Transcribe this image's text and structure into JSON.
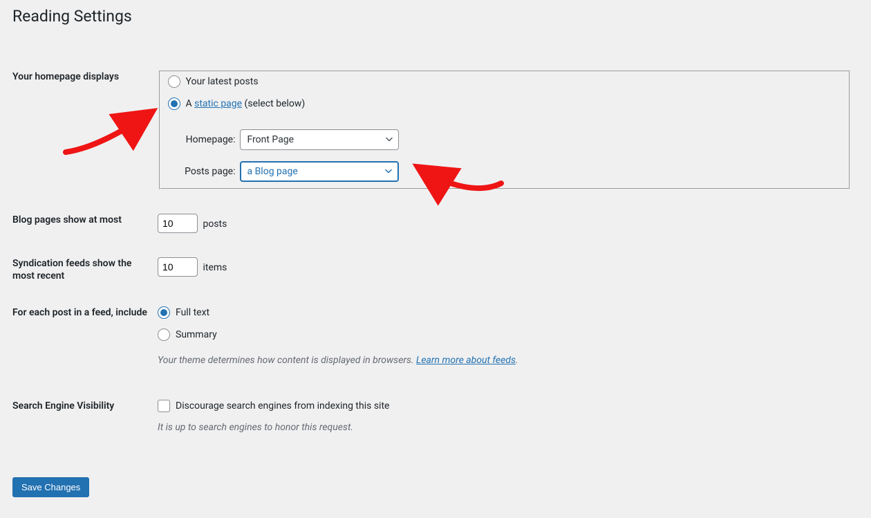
{
  "page": {
    "title": "Reading Settings"
  },
  "homepage": {
    "section_label": "Your homepage displays",
    "opt_latest": "Your latest posts",
    "opt_static_prefix": "A ",
    "static_page_link_text": "static page",
    "opt_static_suffix": " (select below)",
    "homepage_label": "Homepage:",
    "homepage_value": "Front Page",
    "postspage_label": "Posts page:",
    "postspage_value": "a Blog page"
  },
  "blogpages": {
    "section_label": "Blog pages show at most",
    "value": "10",
    "suffix": "posts"
  },
  "syndication": {
    "section_label": "Syndication feeds show the most recent",
    "value": "10",
    "suffix": "items"
  },
  "feedinclude": {
    "section_label": "For each post in a feed, include",
    "opt_full": "Full text",
    "opt_summary": "Summary",
    "note_prefix": "Your theme determines how content is displayed in browsers. ",
    "note_link": "Learn more about feeds",
    "note_suffix": "."
  },
  "sev": {
    "section_label": "Search Engine Visibility",
    "checkbox_label": "Discourage search engines from indexing this site",
    "note": "It is up to search engines to honor this request."
  },
  "submit": {
    "label": "Save Changes"
  }
}
